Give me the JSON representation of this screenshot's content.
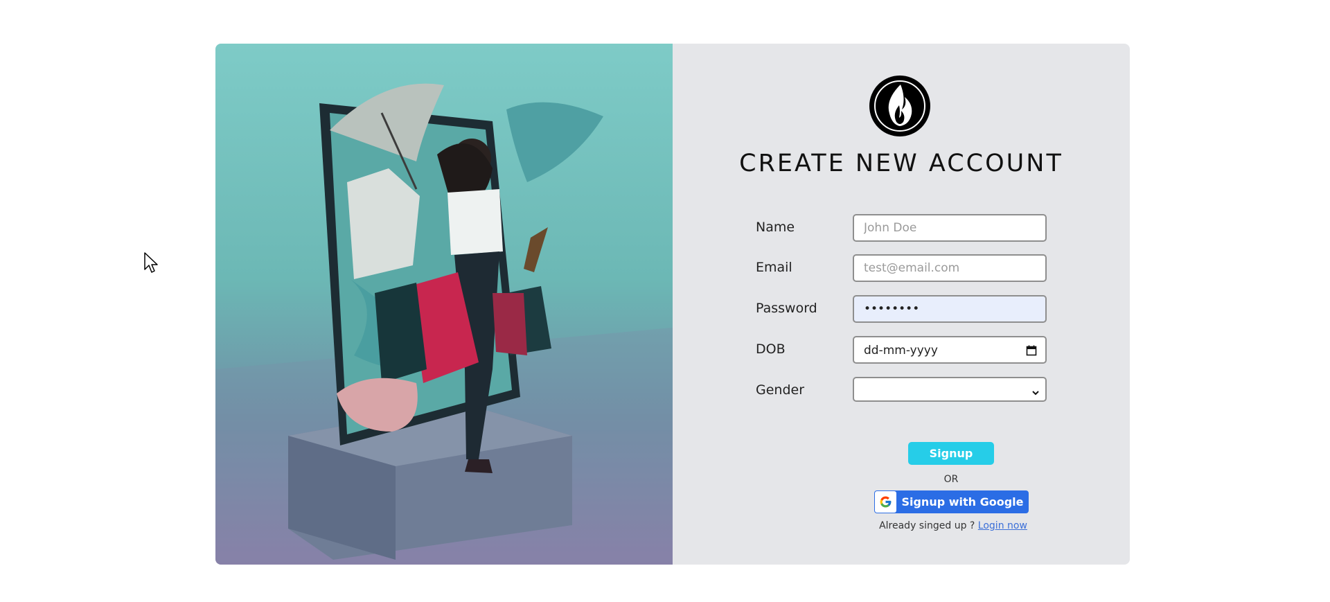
{
  "page": {
    "title": "CREATE NEW ACCOUNT",
    "logo_icon": "flame-logo-icon"
  },
  "form": {
    "name": {
      "label": "Name",
      "placeholder": "John Doe",
      "value": ""
    },
    "email": {
      "label": "Email",
      "placeholder": "test@email.com",
      "value": ""
    },
    "password": {
      "label": "Password",
      "value": "••••••••"
    },
    "dob": {
      "label": "DOB",
      "display": "dd-mm-yyyy",
      "icon": "calendar-icon"
    },
    "gender": {
      "label": "Gender",
      "selected": "",
      "icon": "chevron-down-icon"
    }
  },
  "actions": {
    "signup_label": "Signup",
    "or_label": "OR",
    "google_label": "Signup with Google",
    "google_icon": "google-icon",
    "already_text": "Already singed up ?",
    "login_link": "Login now"
  },
  "colors": {
    "signup_button": "#26cde8",
    "google_button": "#2b6de5",
    "panel_background": "#e5e6e9",
    "link": "#3b6fd8"
  }
}
